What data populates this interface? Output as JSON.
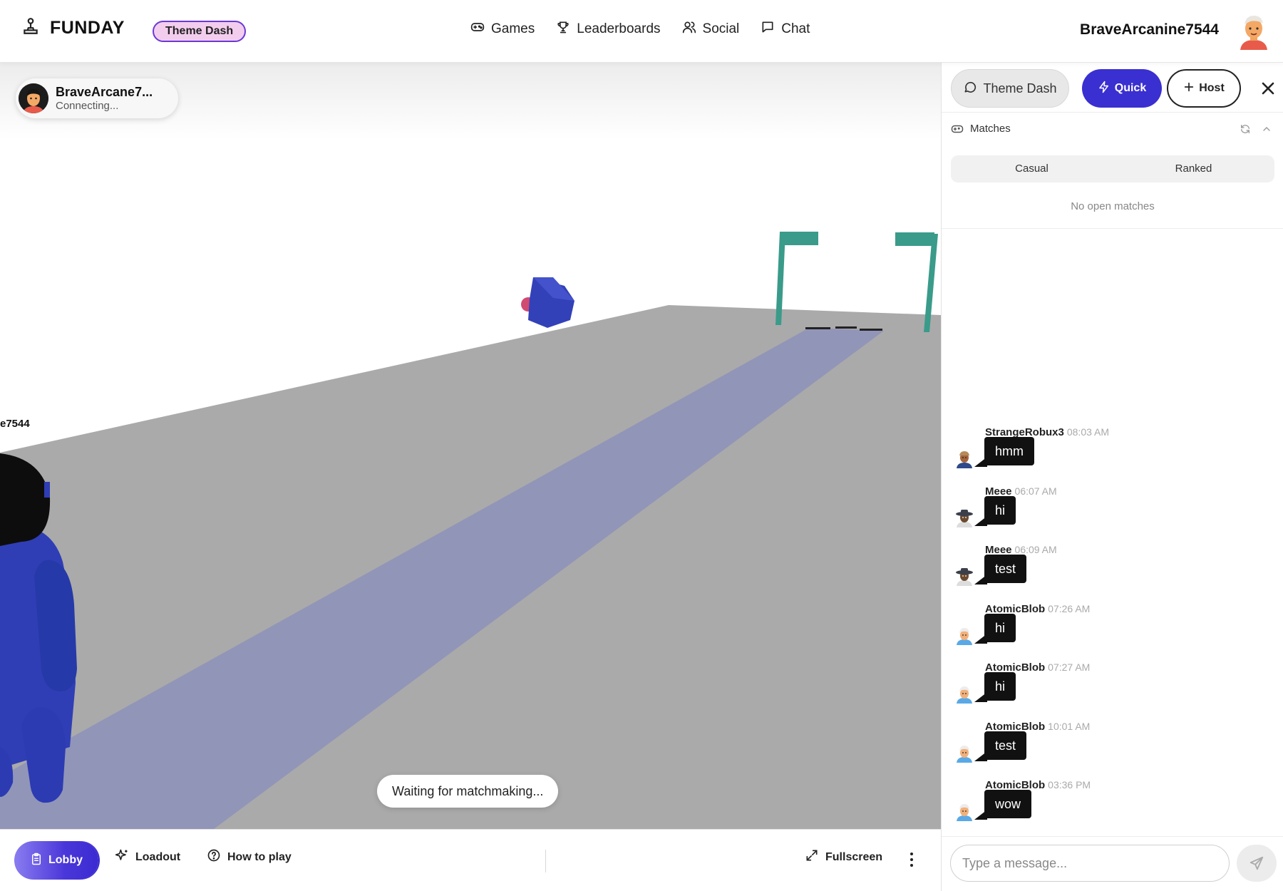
{
  "header": {
    "brand": "FUNDAY",
    "badge": "Theme Dash",
    "nav": [
      {
        "label": "Games",
        "icon": "gamepad-icon"
      },
      {
        "label": "Leaderboards",
        "icon": "trophy-icon"
      },
      {
        "label": "Social",
        "icon": "users-icon"
      },
      {
        "label": "Chat",
        "icon": "message-square-icon"
      }
    ],
    "username": "BraveArcanine7544"
  },
  "game": {
    "player_chip": {
      "name": "BraveArcane7...",
      "status": "Connecting..."
    },
    "name_tag": "e7544",
    "toast": "Waiting for matchmaking..."
  },
  "bottombar": {
    "lobby": "Lobby",
    "loadout": "Loadout",
    "howto": "How to play",
    "fullscreen": "Fullscreen"
  },
  "panel": {
    "tab_theme": "Theme Dash",
    "quick": "Quick",
    "host": "Host",
    "matches_title": "Matches",
    "segments": [
      "Casual",
      "Ranked"
    ],
    "no_matches": "No open matches",
    "messages": [
      {
        "user": "StrangeRobux3",
        "time": "08:03 AM",
        "text": "hmm",
        "avatar": "avatar-brown-cap"
      },
      {
        "user": "Meee",
        "time": "06:07 AM",
        "text": "hi",
        "avatar": "avatar-hat"
      },
      {
        "user": "Meee",
        "time": "06:09 AM",
        "text": "test",
        "avatar": "avatar-hat"
      },
      {
        "user": "AtomicBlob",
        "time": "07:26 AM",
        "text": "hi",
        "avatar": "avatar-blonde"
      },
      {
        "user": "AtomicBlob",
        "time": "07:27 AM",
        "text": "hi",
        "avatar": "avatar-blonde"
      },
      {
        "user": "AtomicBlob",
        "time": "10:01 AM",
        "text": "test",
        "avatar": "avatar-blonde"
      },
      {
        "user": "AtomicBlob",
        "time": "03:36 PM",
        "text": "wow",
        "avatar": "avatar-blonde"
      }
    ],
    "input_placeholder": "Type a message..."
  },
  "colors": {
    "accent": "#3a2fd0",
    "badge_bg": "#f3cdee",
    "ground": "#aaaaaa",
    "track": "#9195b8",
    "goal_post": "#3a9b8a",
    "character": "#2f3eb5"
  }
}
